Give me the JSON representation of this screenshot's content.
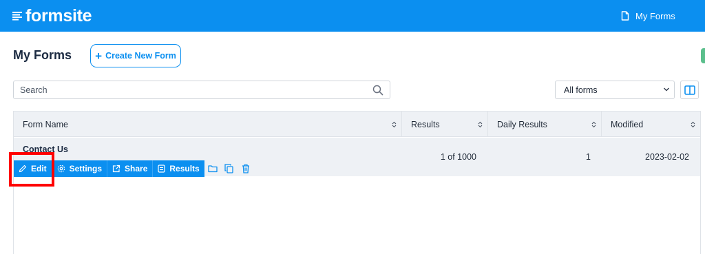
{
  "app": {
    "brand": "formsite",
    "nav_my_forms": "My Forms",
    "colors": {
      "primary": "#0b8ff0",
      "highlight": "#ff0000",
      "accent_green": "#5bbf8c"
    }
  },
  "header": {
    "title": "My Forms",
    "create_button": "Create New Form"
  },
  "toolbar": {
    "search_placeholder": "Search",
    "filter_selected": "All forms",
    "icons": {
      "search": "search-icon",
      "layout": "columns-icon"
    }
  },
  "table": {
    "columns": [
      "Form Name",
      "Results",
      "Daily Results",
      "Modified"
    ],
    "rows": [
      {
        "name": "Contact Us",
        "results": "1 of 1000",
        "daily_results": "1",
        "modified": "2023-02-02",
        "actions": [
          "Edit",
          "Settings",
          "Share",
          "Results"
        ],
        "icon_actions": [
          "folder-icon",
          "copy-icon",
          "trash-icon"
        ]
      }
    ]
  }
}
